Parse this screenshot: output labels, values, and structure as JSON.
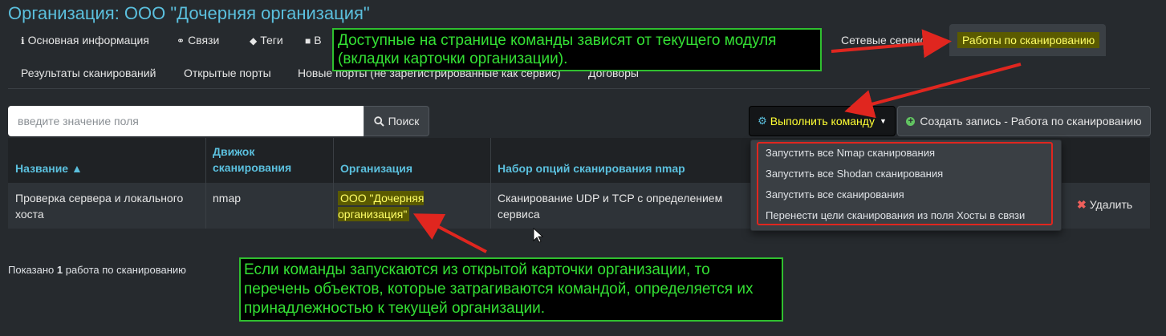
{
  "header": {
    "title": "Организация: ООО \"Дочерняя организация\""
  },
  "tabs": {
    "row1": [
      {
        "label": "Основная информация",
        "icon": "info-icon",
        "icon_glyph": "ℹ"
      },
      {
        "label": "Связи",
        "icon": "link-icon",
        "icon_glyph": "🔗"
      },
      {
        "label": "Теги",
        "icon": "tags-icon",
        "icon_glyph": "🏷"
      },
      {
        "label": "В",
        "icon": "partial-icon",
        "icon_glyph": ""
      },
      {
        "label": "Сетевые сервисы"
      },
      {
        "label": "Работы по сканированию",
        "active": true
      }
    ],
    "row2": [
      {
        "label": "Результаты сканирований"
      },
      {
        "label": "Открытые порты"
      },
      {
        "label": "Новые порты (не зарегистрированные как сервис)"
      },
      {
        "label": "Договоры"
      }
    ]
  },
  "search": {
    "placeholder": "введите значение поля",
    "button_label": "Поиск"
  },
  "toolbar": {
    "run_command_label": "Выполнить команду",
    "create_label": "Создать запись - Работа по сканированию"
  },
  "dropdown": {
    "items": [
      "Запустить все Nmap сканирования",
      "Запустить все Shodan сканирования",
      "Запустить все сканирования",
      "Перенести цели сканирования из поля Хосты в связи"
    ]
  },
  "table": {
    "headers": [
      "Название ▲",
      "Движок сканирования",
      "Организация",
      "Набор опций сканирования nmap"
    ],
    "rows": [
      {
        "name": "Проверка сервера и локального хоста",
        "engine": "nmap",
        "organization": "ООО \"Дочерняя организация\"",
        "options": "Сканирование UDP и TCP с определением сервиса",
        "delete_label": "Удалить"
      }
    ]
  },
  "footer": {
    "prefix": "Показано",
    "count": "1",
    "suffix": "работа по сканированию"
  },
  "annotations": {
    "callout1": "Доступные на странице команды зависят от текущего модуля (вкладки карточки организации).",
    "callout2": "Если команды запускаются из открытой карточки организации, то перечень объектов, которые затрагиваются командой, определяется их принадлежностью к текущей организации."
  },
  "colors": {
    "background": "#262a2e",
    "accent": "#5bc0de",
    "highlight": "#ffff66",
    "callout_border": "#2fbf2f",
    "arrow": "#e0261f"
  }
}
